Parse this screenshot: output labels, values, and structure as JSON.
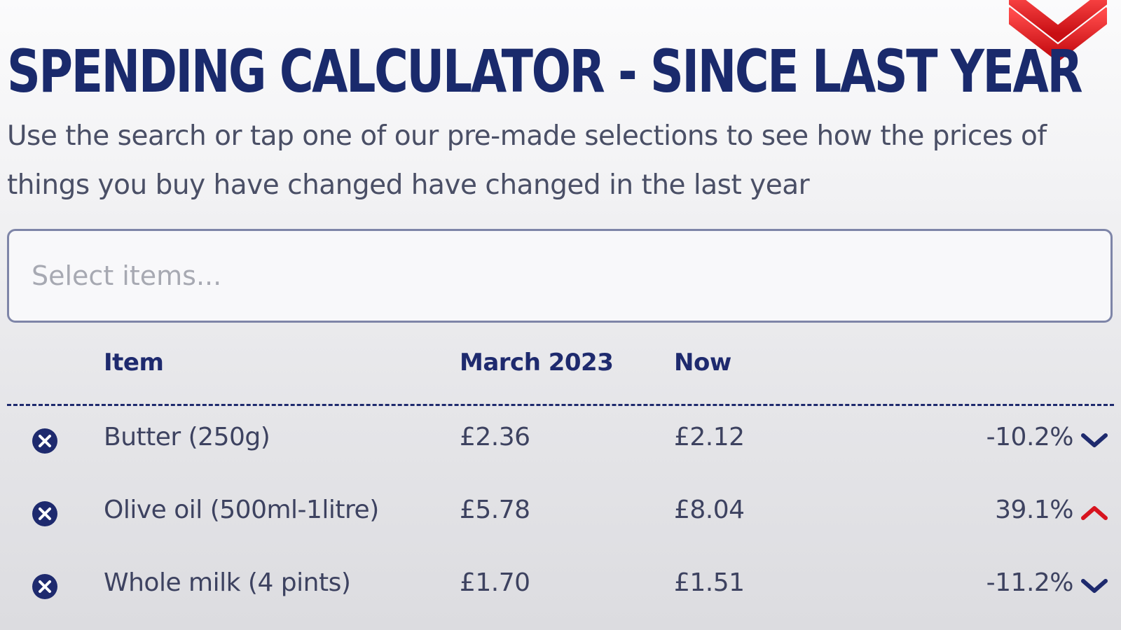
{
  "header": {
    "title": "Spending calculator - since last year",
    "subtitle": "Use the search or tap one of our pre-made selections to see how the prices of things you buy have changed have changed in the last year",
    "logo_icon": "red-double-chevron-icon"
  },
  "search": {
    "placeholder": "Select items...",
    "value": ""
  },
  "table": {
    "columns": {
      "item": "Item",
      "then": "March 2023",
      "now": "Now"
    },
    "rows": [
      {
        "item": "Butter (250g)",
        "then": "£2.36",
        "now": "£2.12",
        "change": "-10.2%",
        "direction": "down"
      },
      {
        "item": "Olive oil (500ml-1litre)",
        "then": "£5.78",
        "now": "£8.04",
        "change": "39.1%",
        "direction": "up"
      },
      {
        "item": "Whole milk (4 pints)",
        "then": "£1.70",
        "now": "£1.51",
        "change": "-11.2%",
        "direction": "down"
      }
    ]
  },
  "colors": {
    "brand_navy": "#1e2a6e",
    "increase_red": "#d7141f",
    "decrease_navy": "#1e2a6e"
  }
}
